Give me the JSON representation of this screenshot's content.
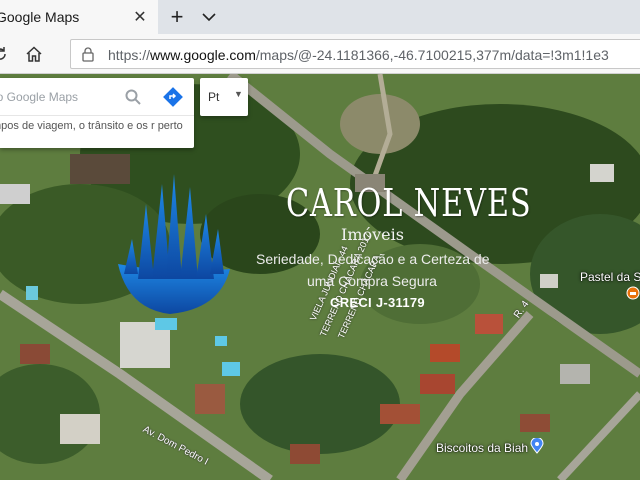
{
  "browser": {
    "tab": {
      "title": "Google Maps"
    },
    "address": {
      "scheme": "https://",
      "host": "www.google.com",
      "path": "/maps/@-24.1181366,-46.7100215,377m/data=!3m1!1e3"
    }
  },
  "maps": {
    "search": {
      "placeholder": "no Google Maps"
    },
    "hint": "mpos de viagem, o trânsito e os r perto",
    "language": "Pt"
  },
  "watermark": {
    "name": "CAROL NEVES",
    "subtitle": "Imóveis",
    "tagline_line1": "Seriedade, Dedicação e a Certeza de",
    "tagline_line2": "uma Compra Segura",
    "creci": "CRECI J-31179"
  },
  "map_labels": {
    "street_dom_pedro": "Av. Dom Pedro I",
    "street_r4": "R. 4",
    "terreno_1": "TERRENO CHÁCARA 2017",
    "terreno_2": "TERRENO CHÁCARA",
    "viela": "VIELA JUNDIAÍ - 44"
  },
  "pois": [
    {
      "name": "Pastel da So"
    },
    {
      "name": "Biscoitos da Biah"
    }
  ],
  "colors": {
    "logo_blue": "#1565c0",
    "directions_blue": "#1a73e8",
    "poi_orange": "#e8710a",
    "poi_blue": "#4285f4"
  }
}
